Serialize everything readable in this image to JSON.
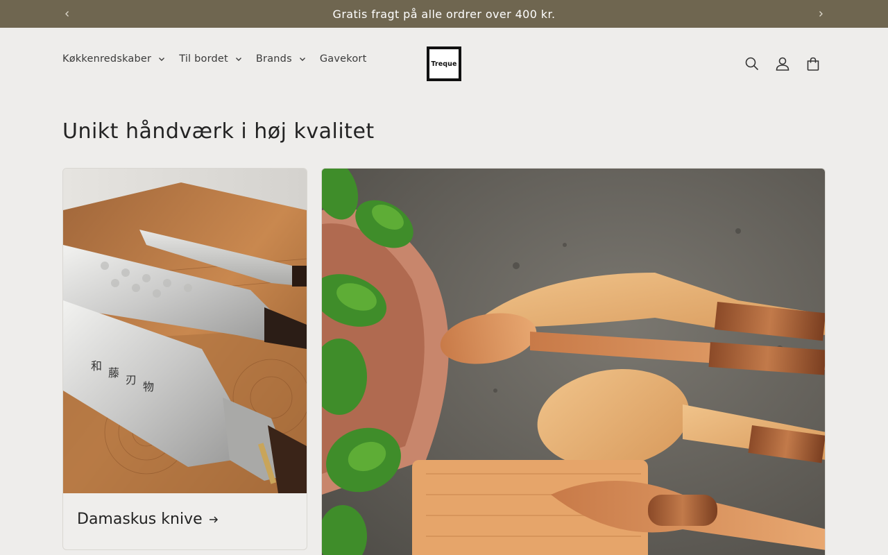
{
  "announcement": {
    "text": "Gratis fragt på alle ordrer over 400 kr."
  },
  "header": {
    "nav": [
      {
        "label": "Køkkenredskaber",
        "has_dropdown": true
      },
      {
        "label": "Til bordet",
        "has_dropdown": true
      },
      {
        "label": "Brands",
        "has_dropdown": true
      },
      {
        "label": "Gavekort",
        "has_dropdown": false
      }
    ],
    "logo_text": "Treque",
    "icons": [
      "search-icon",
      "account-icon",
      "cart-icon"
    ]
  },
  "main": {
    "title": "Unikt håndværk i høj kvalitet",
    "collections": [
      {
        "label": "Damaskus knive",
        "image": "damascus-knives-photo"
      },
      {
        "label": "",
        "image": "wooden-utensils-photo"
      }
    ]
  },
  "colors": {
    "announcement_bg": "#6f6650",
    "page_bg": "#eeedeb",
    "text": "#222222"
  }
}
